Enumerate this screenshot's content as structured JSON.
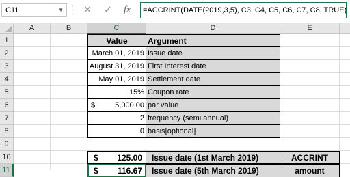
{
  "namebox": {
    "value": "C11"
  },
  "formula_bar": {
    "cancel_glyph": "✕",
    "enter_glyph": "✓",
    "fx_label": "fx",
    "formula": "=ACCRINT(DATE(2019,3,5), C3, C4, C5, C6, C7, C8, TRUE)"
  },
  "columns": [
    "A",
    "B",
    "C",
    "D",
    "E"
  ],
  "rows": [
    "1",
    "2",
    "3",
    "4",
    "5",
    "6",
    "7",
    "8",
    "9",
    "10",
    "11"
  ],
  "selected": {
    "column": "C",
    "row": "11"
  },
  "table": {
    "header_value": "Value",
    "header_argument": "Argument",
    "rows": [
      {
        "value": "March 01, 2019",
        "argument": "Issue date"
      },
      {
        "value": "August 31, 2019",
        "argument": "First Interest date"
      },
      {
        "value": "May 01, 2019",
        "argument": "Settlement date"
      },
      {
        "value": "15%",
        "argument": "Coupon rate"
      },
      {
        "currency": "$",
        "value": "5,000.00",
        "argument": "par value"
      },
      {
        "value": "2",
        "argument": "frequency (semi annual)"
      },
      {
        "value": "0",
        "argument": "basis[optional]"
      }
    ]
  },
  "results": {
    "row10": {
      "currency": "$",
      "value": "125.00",
      "description": "Issue date (1st March 2019)",
      "label": "ACCRINT"
    },
    "row11": {
      "currency": "$",
      "value": "116.67",
      "description": "Issue date (5th March 2019)",
      "label": "amount"
    }
  },
  "colors": {
    "accent": "#1f7145",
    "shaded_cell": "#d9d9d9",
    "header_bg": "#e6e6e6"
  }
}
